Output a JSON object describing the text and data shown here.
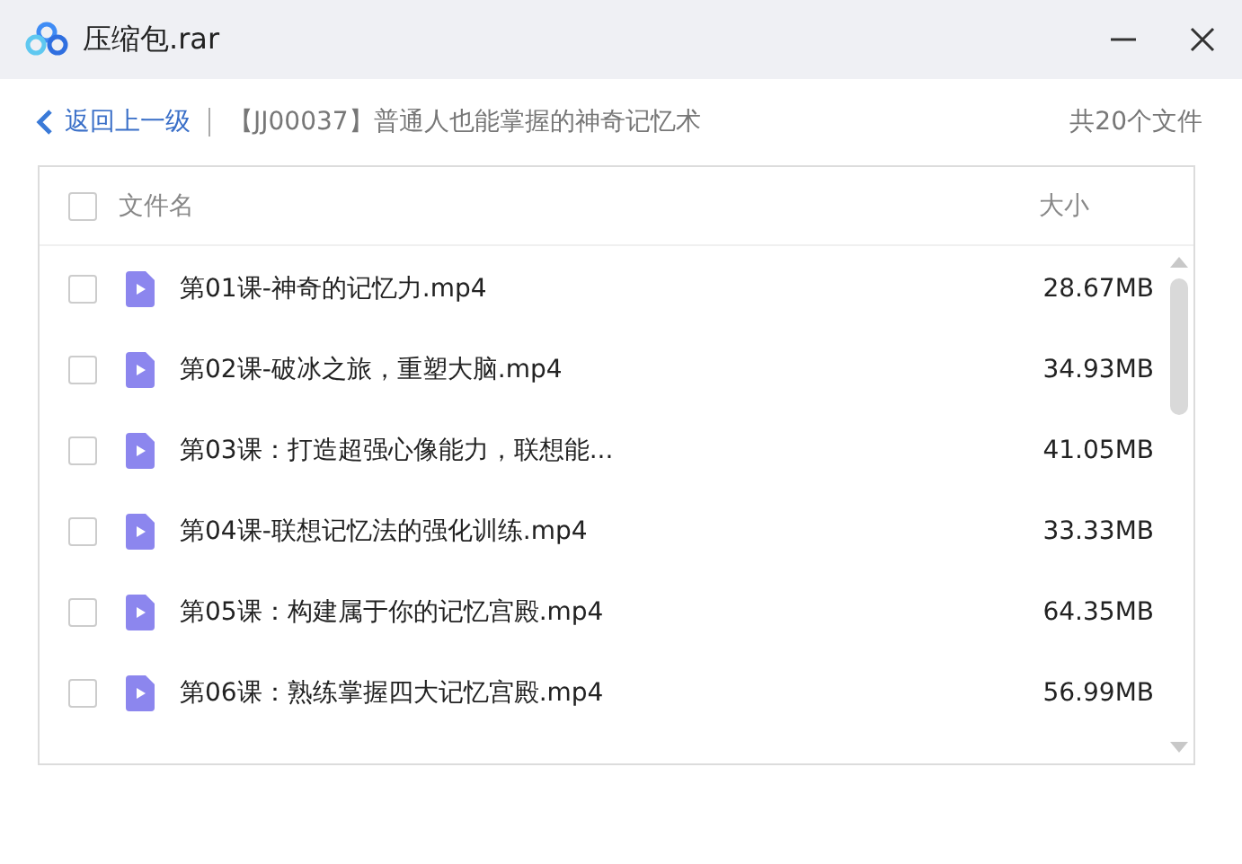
{
  "window": {
    "title": "压缩包.rar"
  },
  "nav": {
    "back": "返回上一级",
    "path": "【JJ00037】普通人也能掌握的神奇记忆术",
    "count": "共20个文件"
  },
  "table": {
    "columns": [
      "文件名",
      "大小"
    ],
    "all_checked": false,
    "rows": [
      {
        "name": "第01课-神奇的记忆力.mp4",
        "size": "28.67MB",
        "checked": false
      },
      {
        "name": "第02课-破冰之旅，重塑大脑.mp4",
        "size": "34.93MB",
        "checked": false
      },
      {
        "name": "第03课：打造超强心像能力，联想能...",
        "size": "41.05MB",
        "checked": false
      },
      {
        "name": "第04课-联想记忆法的强化训练.mp4",
        "size": "33.33MB",
        "checked": false
      },
      {
        "name": "第05课：构建属于你的记忆宫殿.mp4",
        "size": "64.35MB",
        "checked": false
      },
      {
        "name": "第06课：熟练掌握四大记忆宫殿.mp4",
        "size": "56.99MB",
        "checked": false
      }
    ]
  }
}
